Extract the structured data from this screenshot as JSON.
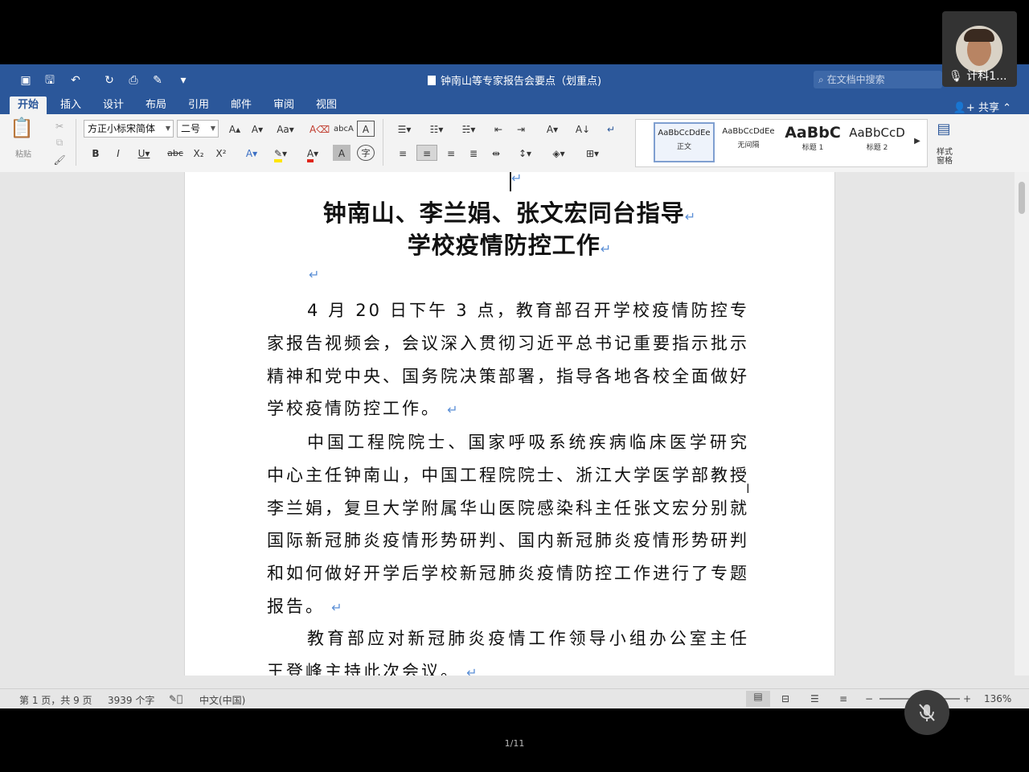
{
  "window": {
    "title": "钟南山等专家报告会要点（划重点)",
    "search_placeholder": "在文档中搜索"
  },
  "tabs": [
    "开始",
    "插入",
    "设计",
    "布局",
    "引用",
    "邮件",
    "审阅",
    "视图"
  ],
  "share_label": "共享",
  "ribbon": {
    "paste_label": "粘贴",
    "font_name": "方正小标宋简体",
    "font_size": "二号",
    "styles": [
      {
        "preview": "AaBbCcDdEe",
        "name": "正文"
      },
      {
        "preview": "AaBbCcDdEe",
        "name": "无间隔"
      },
      {
        "preview": "AaBbC",
        "name": "标题 1"
      },
      {
        "preview": "AaBbCcD",
        "name": "标题 2"
      }
    ],
    "styles_pane_label": "样式\n窗格"
  },
  "document": {
    "title_line1": "钟南山、李兰娟、张文宏同台指导",
    "title_line2": "学校疫情防控工作",
    "paragraphs": [
      "4 月 20 日下午 3 点，教育部召开学校疫情防控专家报告视频会，会议深入贯彻习近平总书记重要指示批示精神和党中央、国务院决策部署，指导各地各校全面做好学校疫情防控工作。",
      "中国工程院院士、国家呼吸系统疾病临床医学研究中心主任钟南山，中国工程院院士、浙江大学医学部教授李兰娟，复旦大学附属华山医院感染科主任张文宏分别就国际新冠肺炎疫情形势研判、国内新冠肺炎疫情形势研判和如何做好开学后学校新冠肺炎疫情防控工作进行了专题报告。",
      "教育部应对新冠肺炎疫情工作领导小组办公室主任王登峰主持此次会议。"
    ]
  },
  "status": {
    "page": "第 1 页，共 9 页",
    "words": "3939 个字",
    "language": "中文(中国)",
    "zoom": "136%"
  },
  "meeting": {
    "participant": "计科1...",
    "slide_counter": "1/11"
  }
}
